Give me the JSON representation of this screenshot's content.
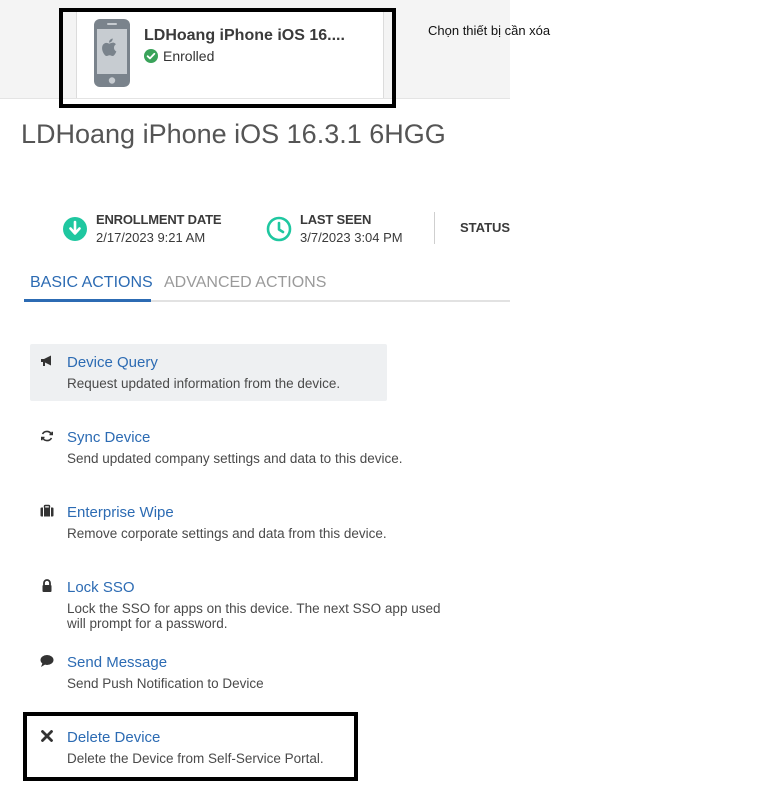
{
  "device_card": {
    "name": "LDHoang iPhone iOS 16....",
    "status": "Enrolled",
    "icons": {
      "device": "iphone-icon",
      "status": "check-circle-icon"
    }
  },
  "annotation": {
    "text": "Chọn thiết bị cần xóa"
  },
  "device_title": "LDHoang iPhone iOS 16.3.1 6HGG",
  "info": {
    "enrollment": {
      "label": "ENROLLMENT DATE",
      "value": "2/17/2023 9:21 AM",
      "icon": "download-arrow-icon"
    },
    "last_seen": {
      "label": "LAST SEEN",
      "value": "3/7/2023 3:04 PM",
      "icon": "clock-icon"
    },
    "status": {
      "label": "STATUS"
    }
  },
  "tabs": [
    {
      "label": "BASIC ACTIONS",
      "active": true
    },
    {
      "label": "ADVANCED ACTIONS",
      "active": false
    }
  ],
  "actions": [
    {
      "title": "Device Query",
      "desc": "Request updated information from the device.",
      "icon": "megaphone-icon"
    },
    {
      "title": "Sync Device",
      "desc": "Send updated company settings and data to this device.",
      "icon": "sync-icon"
    },
    {
      "title": "Enterprise Wipe",
      "desc": "Remove corporate settings and data from this device.",
      "icon": "briefcase-icon"
    },
    {
      "title": "Lock SSO",
      "desc": "Lock the SSO for apps on this device. The next SSO app used will prompt for a password.",
      "icon": "lock-icon"
    },
    {
      "title": "Send Message",
      "desc": "Send Push Notification to Device",
      "icon": "chat-bubble-icon"
    },
    {
      "title": "Delete Device",
      "desc": "Delete the Device from Self-Service Portal.",
      "icon": "close-x-icon"
    }
  ],
  "colors": {
    "accent": "#2c6bb3",
    "status_green": "#3aa35a",
    "info_teal": "#1fc7a0"
  }
}
